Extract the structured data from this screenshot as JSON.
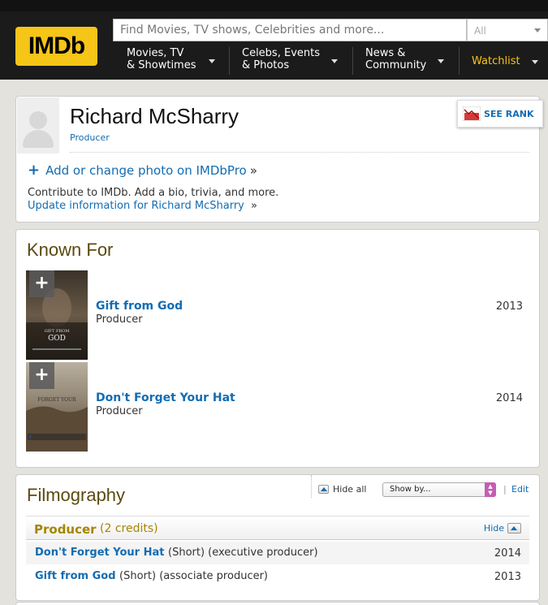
{
  "header": {
    "logo_text": "IMDb",
    "search_placeholder": "Find Movies, TV shows, Celebrities and more...",
    "search_category": "All",
    "nav": [
      {
        "line1": "Movies, TV",
        "line2": "& Showtimes"
      },
      {
        "line1": "Celebs, Events",
        "line2": "& Photos"
      },
      {
        "line1": "News &",
        "line2": "Community"
      }
    ],
    "watchlist": "Watchlist"
  },
  "person": {
    "name": "Richard McSharry",
    "role": "Producer",
    "see_rank": "SEE RANK",
    "add_photo": "Add or change photo on IMDbPro",
    "contribute": "Contribute to IMDb. Add a bio, trivia, and more.",
    "update_link": "Update information for Richard McSharry"
  },
  "known_for": {
    "title": "Known For",
    "items": [
      {
        "title": "Gift from God",
        "role": "Producer",
        "year": "2013",
        "poster_text": "GIFT FROM GOD"
      },
      {
        "title": "Don't Forget Your Hat",
        "role": "Producer",
        "year": "2014",
        "poster_text": "DON'T FORGET YOUR HAT"
      }
    ]
  },
  "filmography": {
    "title": "Filmography",
    "hide_all": "Hide all",
    "show_by": "Show by...",
    "edit": "Edit",
    "section": {
      "label": "Producer",
      "count": "(2 credits)",
      "hide": "Hide"
    },
    "rows": [
      {
        "title": "Don't Forget Your Hat",
        "meta": "(Short) (executive producer)",
        "year": "2014"
      },
      {
        "title": "Gift from God",
        "meta": "(Short) (associate producer)",
        "year": "2013"
      }
    ]
  },
  "colors": {
    "brand_yellow": "#f5c518",
    "link_blue": "#136cb2",
    "section_gold": "#a58500"
  }
}
